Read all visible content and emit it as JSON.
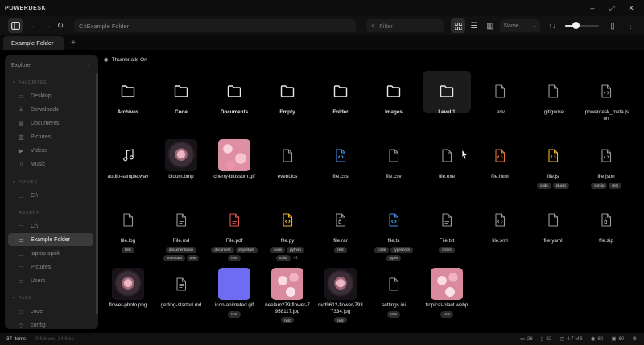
{
  "app": {
    "title": "POWERDESK"
  },
  "window_controls": {
    "minimize": "–",
    "maximize": "⤢",
    "close": "✕"
  },
  "toolbar": {
    "path": "C:\\Example Folder",
    "search_placeholder": "Filter",
    "sort_by": "Name",
    "sort_order_icon": "↑↓",
    "zoom_level": 0.32
  },
  "tabs": [
    {
      "label": "Example Folder"
    }
  ],
  "tab_add": "+",
  "sidebar": {
    "header": "Explorer",
    "collapse": "‹",
    "sections": {
      "favorites": "FAVORITES",
      "drives": "DRIVES",
      "recent": "RECENT",
      "tags": "TAGS"
    },
    "favorites": [
      {
        "label": "Desktop",
        "icon": "desktop-icon",
        "glyph": "▭"
      },
      {
        "label": "Downloads",
        "icon": "download-icon",
        "glyph": "⤓"
      },
      {
        "label": "Documents",
        "icon": "document-icon",
        "glyph": "▤"
      },
      {
        "label": "Pictures",
        "icon": "image-icon",
        "glyph": "▨"
      },
      {
        "label": "Videos",
        "icon": "video-icon",
        "glyph": "▶"
      },
      {
        "label": "Music",
        "icon": "music-icon",
        "glyph": "♫"
      }
    ],
    "drives": [
      {
        "label": "C:\\",
        "icon": "drive-icon",
        "glyph": "▭"
      }
    ],
    "recent": [
      {
        "label": "C:\\",
        "icon": "folder-icon",
        "glyph": "▭"
      },
      {
        "label": "Example Folder",
        "icon": "folder-icon",
        "glyph": "▭",
        "active": true
      },
      {
        "label": "laptop spirit",
        "icon": "folder-icon",
        "glyph": "▭"
      },
      {
        "label": "Pictures",
        "icon": "folder-icon",
        "glyph": "▭"
      },
      {
        "label": "Users",
        "icon": "folder-icon",
        "glyph": "▭"
      }
    ],
    "tags": [
      {
        "label": "code",
        "icon": "tag-icon",
        "glyph": "◇"
      },
      {
        "label": "config",
        "icon": "tag-icon",
        "glyph": "◇"
      }
    ]
  },
  "content": {
    "thumbnails_toggle": "Thumbnails On",
    "items": [
      {
        "name": "Archives",
        "type": "folder",
        "bold": true
      },
      {
        "name": "Code",
        "type": "folder",
        "bold": true
      },
      {
        "name": "Documents",
        "type": "folder",
        "bold": true
      },
      {
        "name": "Empty",
        "type": "folder",
        "bold": true
      },
      {
        "name": "Folder",
        "type": "folder",
        "bold": true
      },
      {
        "name": "Images",
        "type": "folder",
        "bold": true
      },
      {
        "name": "Level 1",
        "type": "folder",
        "bold": true,
        "highlight": true
      },
      {
        "name": ".env",
        "type": "file"
      },
      {
        "name": ".gitignore",
        "type": "file"
      },
      {
        "name": ".powerdesk_meta.json",
        "type": "code"
      },
      {
        "name": "audio-sample.wav",
        "type": "audio"
      },
      {
        "name": "bloom.bmp",
        "type": "thumb",
        "thumb": "dark"
      },
      {
        "name": "cherry-blossom.gif",
        "type": "thumb",
        "thumb": "pink"
      },
      {
        "name": "event.ics",
        "type": "file"
      },
      {
        "name": "file.css",
        "type": "code",
        "color": "#4a8fe7"
      },
      {
        "name": "file.csv",
        "type": "file"
      },
      {
        "name": "file.exe",
        "type": "file"
      },
      {
        "name": "file.html",
        "type": "code",
        "color": "#e8743b"
      },
      {
        "name": "file.js",
        "type": "code",
        "color": "#f0b429",
        "tags": [
          "code",
          "plugin"
        ]
      },
      {
        "name": "file.json",
        "type": "code",
        "tags": [
          "config",
          "test"
        ]
      },
      {
        "name": "file.log",
        "type": "file",
        "tags": [
          "test"
        ]
      },
      {
        "name": "File.md",
        "type": "doc",
        "tags": [
          "documentation",
          "important",
          "test"
        ]
      },
      {
        "name": "File.pdf",
        "type": "doc",
        "color": "#e5534b",
        "tags": [
          "document",
          "important",
          "test"
        ]
      },
      {
        "name": "file.py",
        "type": "code",
        "color": "#f0b429",
        "tags": [
          "code",
          "python",
          "utility"
        ],
        "more": "+1"
      },
      {
        "name": "file.rar",
        "type": "zip",
        "tags": [
          "test"
        ]
      },
      {
        "name": "file.ts",
        "type": "code",
        "color": "#4a8fe7",
        "tags": [
          "code",
          "typescript",
          "types"
        ]
      },
      {
        "name": "File.txt",
        "type": "doc",
        "tags": [
          "notes"
        ]
      },
      {
        "name": "file.xml",
        "type": "code"
      },
      {
        "name": "file.yaml",
        "type": "file"
      },
      {
        "name": "file.zip",
        "type": "zip"
      },
      {
        "name": "flower-photo.png",
        "type": "thumb",
        "thumb": "dark"
      },
      {
        "name": "getting-started.md",
        "type": "doc"
      },
      {
        "name": "icon-animated.gif",
        "type": "thumb",
        "thumb": "purple",
        "tags": [
          "test"
        ]
      },
      {
        "name": "neelam279-flower-7958117.jpg",
        "type": "thumb",
        "thumb": "pink2",
        "tags": [
          "test"
        ]
      },
      {
        "name": "nvd9612-flower-7937334.jpg",
        "type": "thumb",
        "thumb": "dark",
        "tags": [
          "test"
        ]
      },
      {
        "name": "settings.ini",
        "type": "file",
        "tags": [
          "test"
        ]
      },
      {
        "name": "tropical-plant.webp",
        "type": "thumb",
        "thumb": "pink2",
        "tags": [
          "test"
        ]
      }
    ]
  },
  "status": {
    "count": "37 Items",
    "selection": "0 folders, 34 files",
    "stats": [
      {
        "icon": "folder-icon",
        "glyph": "▭",
        "value": "26"
      },
      {
        "icon": "file-icon",
        "glyph": "▯",
        "value": "32"
      },
      {
        "icon": "clock-icon",
        "glyph": "◷",
        "value": "4.7 MB"
      },
      {
        "icon": "eye-icon",
        "glyph": "◉",
        "value": "80"
      },
      {
        "icon": "display-icon",
        "glyph": "▣",
        "value": "60"
      },
      {
        "icon": "settings-icon",
        "glyph": "⚙",
        "value": ""
      }
    ]
  },
  "colors": {
    "background": "#000000",
    "panel": "#1e1e1e",
    "accent": "#ffffff"
  }
}
